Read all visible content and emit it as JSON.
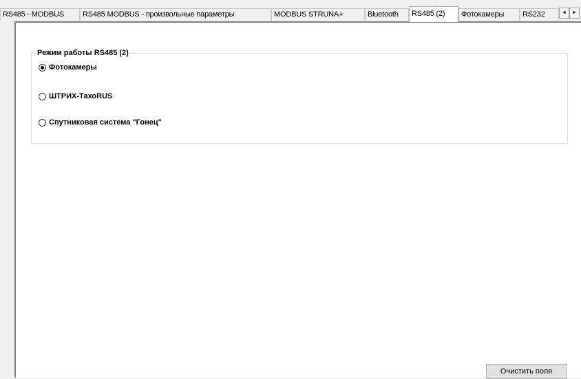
{
  "tabs": [
    {
      "label": "RS485 - MODBUS"
    },
    {
      "label": "RS485 MODBUS - произвольные параметры"
    },
    {
      "label": "MODBUS STRUNA+"
    },
    {
      "label": "Bluetooth"
    },
    {
      "label": "RS485 (2)",
      "active": true
    },
    {
      "label": "Фотокамеры"
    },
    {
      "label": "RS232"
    }
  ],
  "tab_scroll": {
    "left_glyph": "◄",
    "right_glyph": "►"
  },
  "group": {
    "title": "Режим работы RS485 (2)",
    "options": [
      {
        "label": "Фотокамеры",
        "selected": true
      },
      {
        "label": "ШТРИХ-ТахоRUS",
        "selected": false
      },
      {
        "label": "Спутниковая система \"Гонец\"",
        "selected": false
      }
    ]
  },
  "buttons": {
    "clear": "Очистить поля"
  }
}
